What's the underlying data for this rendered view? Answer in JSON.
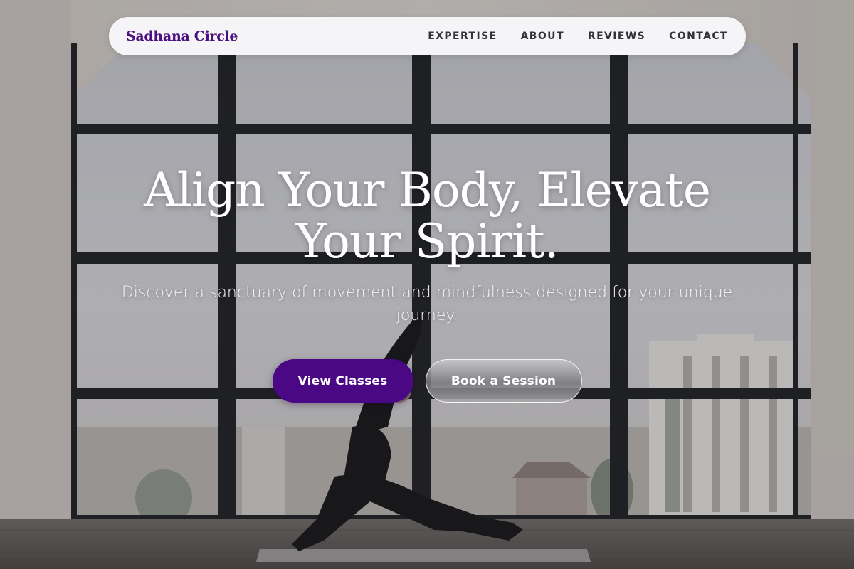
{
  "navbar": {
    "brand": "Sadhana Circle",
    "links": [
      "EXPERTISE",
      "ABOUT",
      "REVIEWS",
      "CONTACT"
    ]
  },
  "hero": {
    "title_line1": "Align Your Body, Elevate",
    "title_line2": "Your Spirit.",
    "subtitle": "Discover a sanctuary of movement and mindfulness designed for your unique journey.",
    "primary_button": "View Classes",
    "secondary_button": "Book a Session"
  },
  "colors": {
    "brand": "#4b0f82",
    "primary_button": "#4a0884",
    "navbar_bg": "#f5f4f6",
    "nav_text": "#333339"
  },
  "background_image": "yoga-studio-photo"
}
